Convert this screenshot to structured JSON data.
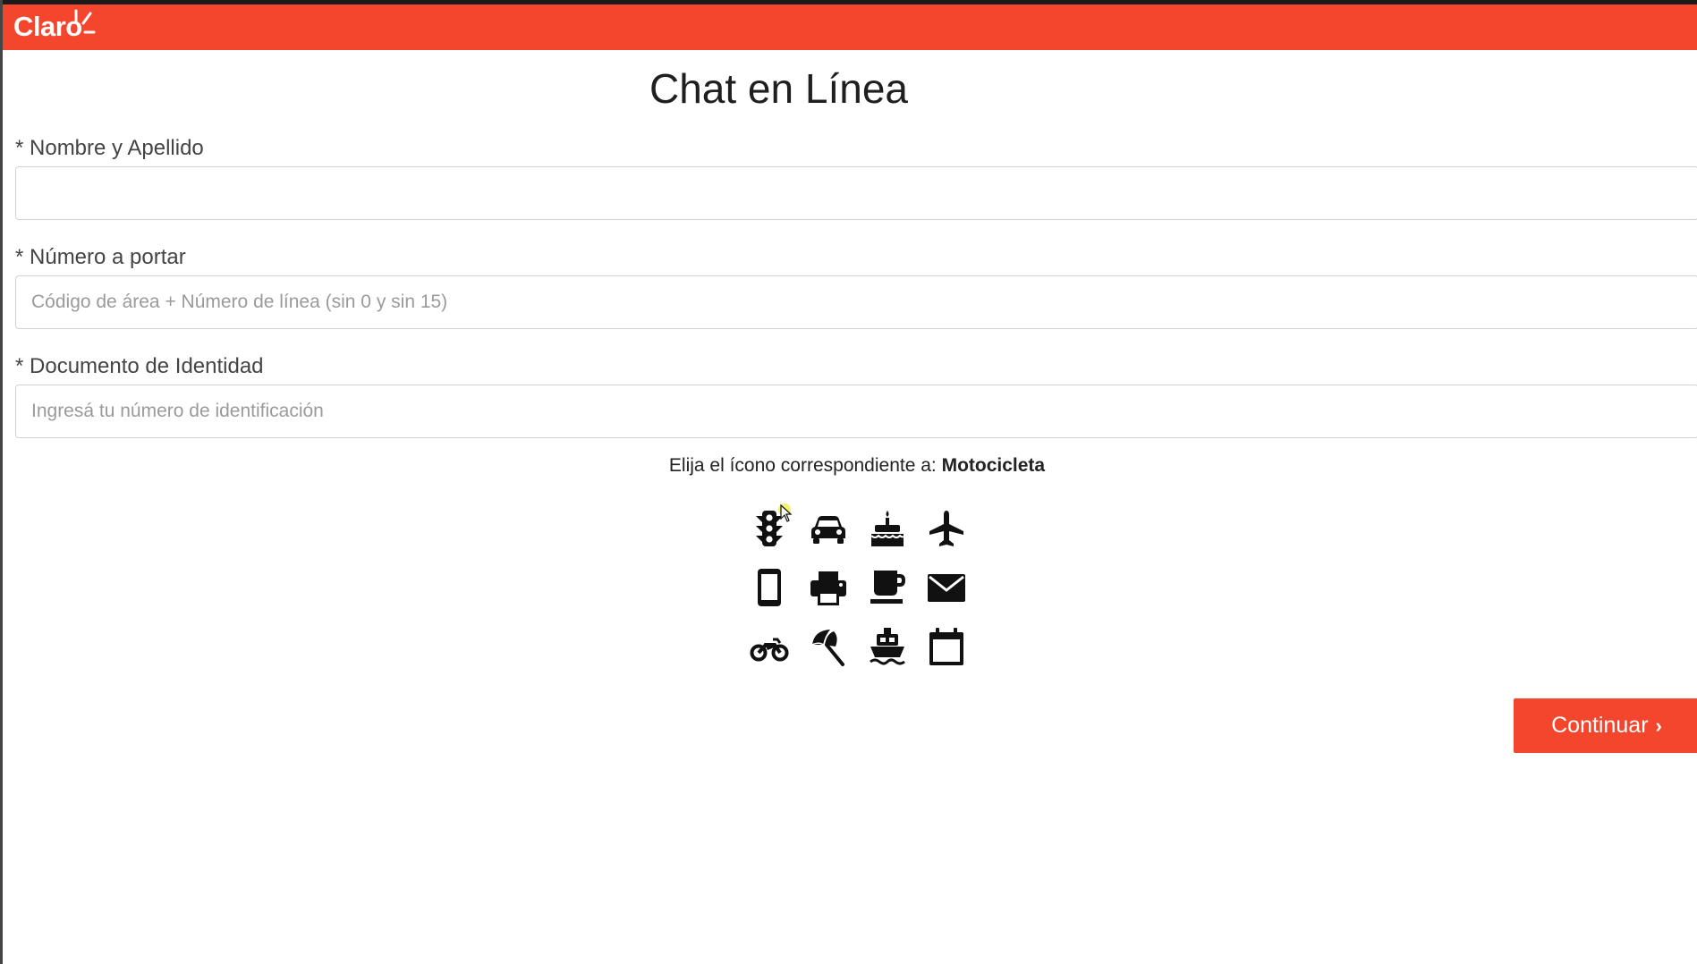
{
  "brand": {
    "logo_text": "Claro",
    "color": "#f4462d"
  },
  "page": {
    "title": "Chat en Línea"
  },
  "form": {
    "name_label": "* Nombre y Apellido",
    "name_value": "",
    "name_placeholder": "",
    "number_label": "* Número a portar",
    "number_value": "",
    "number_placeholder": "Código de área + Número de línea (sin 0 y sin 15)",
    "document_label": "* Documento de Identidad",
    "document_value": "",
    "document_placeholder": "Ingresá tu número de identificación"
  },
  "captcha": {
    "prompt": "Elija el ícono correspondiente a: ",
    "target": "Motocicleta",
    "icons": [
      "traffic-light-icon",
      "car-icon",
      "birthday-cake-icon",
      "plane-icon",
      "mobile-phone-icon",
      "printer-icon",
      "coffee-cup-icon",
      "envelope-icon",
      "motorcycle-icon",
      "beach-umbrella-icon",
      "ship-icon",
      "calendar-icon"
    ]
  },
  "actions": {
    "continue_label": "Continuar",
    "continue_icon": "chevron-right-icon"
  }
}
